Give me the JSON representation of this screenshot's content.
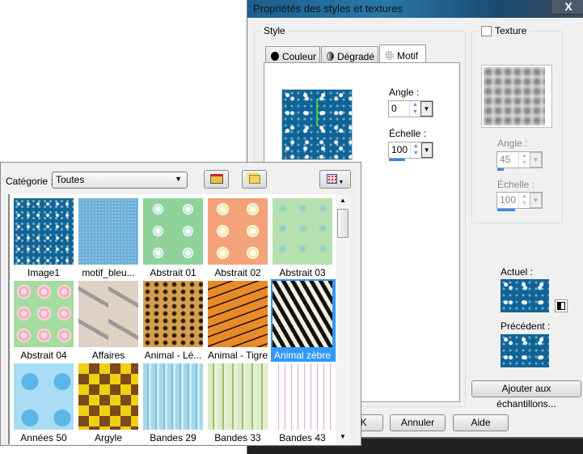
{
  "dialog": {
    "title": "Propriétés des styles et textures",
    "close_label": "X",
    "style_group": "Style",
    "tabs": [
      {
        "label": "Couleur"
      },
      {
        "label": "Dégradé"
      },
      {
        "label": "Motif"
      }
    ],
    "active_tab": "Motif",
    "angle_label": "Angle :",
    "angle_value": "0",
    "scale_label": "Échelle :",
    "scale_value": "100",
    "texture": {
      "label": "Texture",
      "checked": false,
      "angle_label": "Angle :",
      "angle_value": "45",
      "scale_label": "Échelle :",
      "scale_value": "100"
    },
    "current_label": "Actuel :",
    "previous_label": "Précédent :",
    "add_swatch_button": "Ajouter aux échantillons...",
    "ok_button": "OK",
    "cancel_button": "Annuler",
    "help_button": "Aide"
  },
  "popup": {
    "category_label": "Catégorie :",
    "category_value": "Toutes",
    "patterns": [
      {
        "label": "Image1"
      },
      {
        "label": "motif_bleu..."
      },
      {
        "label": "Abstrait 01"
      },
      {
        "label": "Abstrait 02"
      },
      {
        "label": "Abstrait 03"
      },
      {
        "label": "Abstrait 04"
      },
      {
        "label": "Affaires"
      },
      {
        "label": "Animal - Lé..."
      },
      {
        "label": "Animal - Tigre"
      },
      {
        "label": "Animal zèbre"
      },
      {
        "label": "Années 50"
      },
      {
        "label": "Argyle"
      },
      {
        "label": "Bandes 29"
      },
      {
        "label": "Bandes 33"
      },
      {
        "label": "Bandes 43"
      }
    ],
    "selected": "Animal zèbre"
  }
}
